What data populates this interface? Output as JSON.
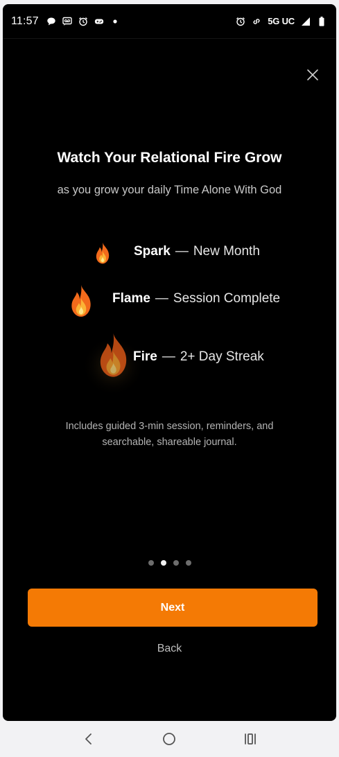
{
  "status_bar": {
    "time": "11:57",
    "left_icons": [
      "chat-bubble-icon",
      "voicemail-icon",
      "alarm-icon",
      "game-controller-icon",
      "notification-dot-icon"
    ],
    "right_icons": [
      "alarm-icon",
      "link-icon",
      "cell-signal-icon",
      "battery-icon"
    ],
    "network": "5G UC"
  },
  "onboarding": {
    "title": "Watch Your Relational Fire Grow",
    "subtitle": "as you grow your daily Time Alone With God",
    "tiers": [
      {
        "name": "Spark",
        "dash": "—",
        "description": "New Month",
        "icon": "small-fire-icon"
      },
      {
        "name": "Flame",
        "dash": "—",
        "description": "Session Complete",
        "icon": "medium-fire-icon"
      },
      {
        "name": "Fire",
        "dash": "—",
        "description": "2+ Day Streak",
        "icon": "large-fire-icon"
      }
    ],
    "description": "Includes guided 3-min session, reminders, and searchable, shareable journal.",
    "pager": {
      "total": 4,
      "active_index": 1
    },
    "next_label": "Next",
    "back_label": "Back",
    "close_icon": "close-icon"
  },
  "colors": {
    "accent": "#f47a05",
    "background": "#000000",
    "text_primary": "#ffffff",
    "text_secondary": "#c8c8c8"
  },
  "nav_bar": {
    "buttons": [
      "back-chevron-icon",
      "home-circle-icon",
      "recents-icon"
    ]
  }
}
